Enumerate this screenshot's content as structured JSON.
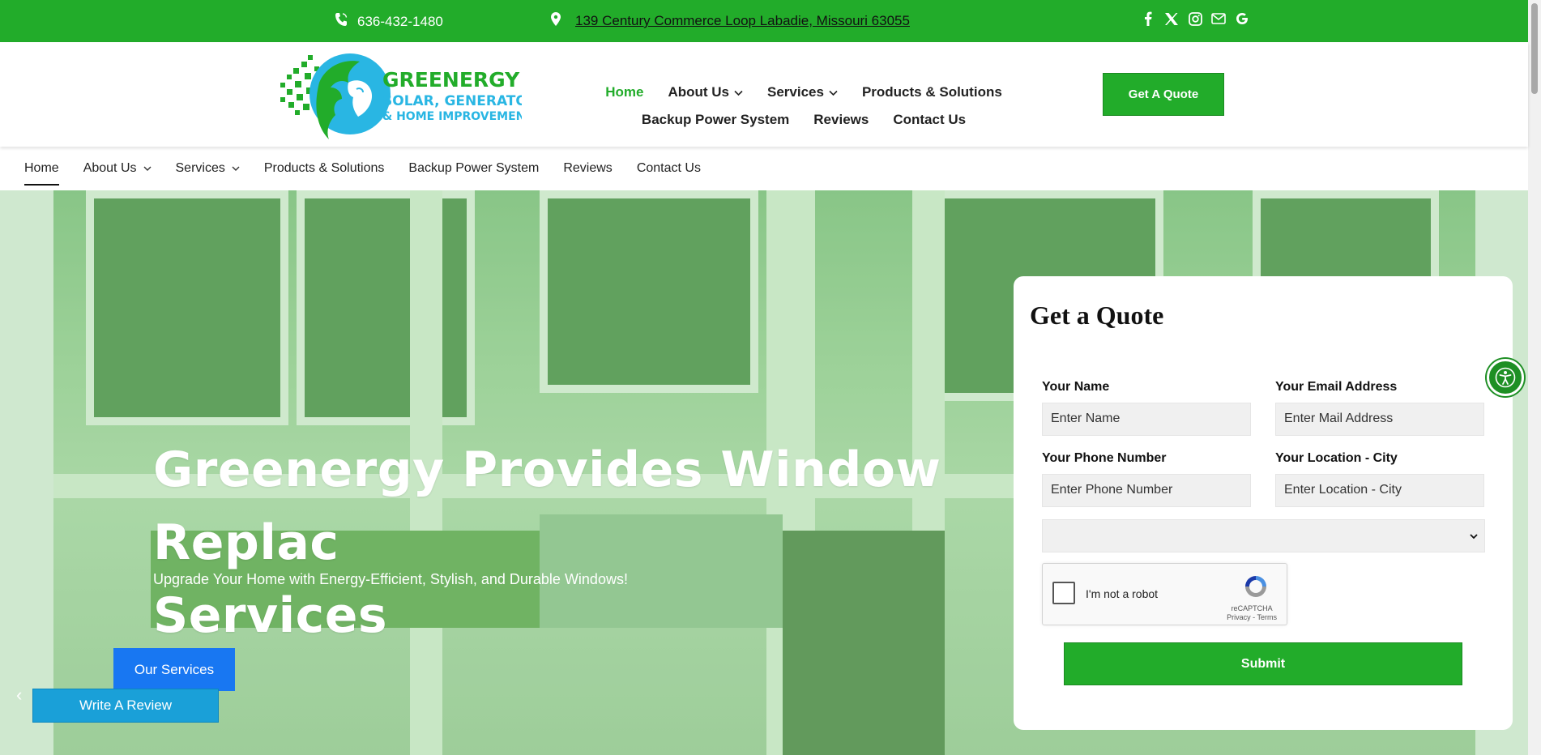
{
  "topbar": {
    "phone": "636-432-1480",
    "address": "139 Century Commerce Loop Labadie, Missouri 63055",
    "social_icons": [
      "facebook-icon",
      "x-icon",
      "instagram-icon",
      "mail-icon",
      "google-icon"
    ]
  },
  "logo": {
    "line1": "GREENERGY",
    "line2": "SOLAR, GENERATOR",
    "line3": "& HOME IMPROVEMENTS"
  },
  "mainnav": {
    "row1": [
      {
        "label": "Home",
        "active": true,
        "dropdown": false
      },
      {
        "label": "About Us",
        "dropdown": true
      },
      {
        "label": "Services",
        "dropdown": true
      },
      {
        "label": "Products & Solutions",
        "dropdown": false
      }
    ],
    "row2": [
      {
        "label": "Backup Power System"
      },
      {
        "label": "Reviews"
      },
      {
        "label": "Contact Us"
      }
    ],
    "quote_button": "Get A Quote"
  },
  "subnav": [
    {
      "label": "Home",
      "active": true
    },
    {
      "label": "About Us",
      "dropdown": true
    },
    {
      "label": "Services",
      "dropdown": true
    },
    {
      "label": "Products & Solutions"
    },
    {
      "label": "Backup Power System"
    },
    {
      "label": "Reviews"
    },
    {
      "label": "Contact Us"
    }
  ],
  "hero": {
    "title": "Greenergy Provides Window Replac\nServices",
    "subtitle": "Upgrade Your Home with Energy-Efficient, Stylish, and Durable Windows!",
    "services_button": "Our Services",
    "review_button": "Write A Review"
  },
  "form": {
    "title": "Get a Quote",
    "name_label": "Your Name",
    "name_placeholder": "Enter Name",
    "email_label": "Your Email Address",
    "email_placeholder": "Enter Mail Address",
    "phone_label": "Your Phone Number",
    "phone_placeholder": "Enter Phone Number",
    "city_label": "Your Location - City",
    "city_placeholder": "Enter Location - City",
    "recaptcha_text": "I'm not a robot",
    "recaptcha_brand": "reCAPTCHA",
    "recaptcha_links": "Privacy - Terms",
    "submit": "Submit"
  },
  "colors": {
    "brand_green": "#22ac2a",
    "button_blue": "#1877f2",
    "review_blue": "#1aa0d8"
  }
}
